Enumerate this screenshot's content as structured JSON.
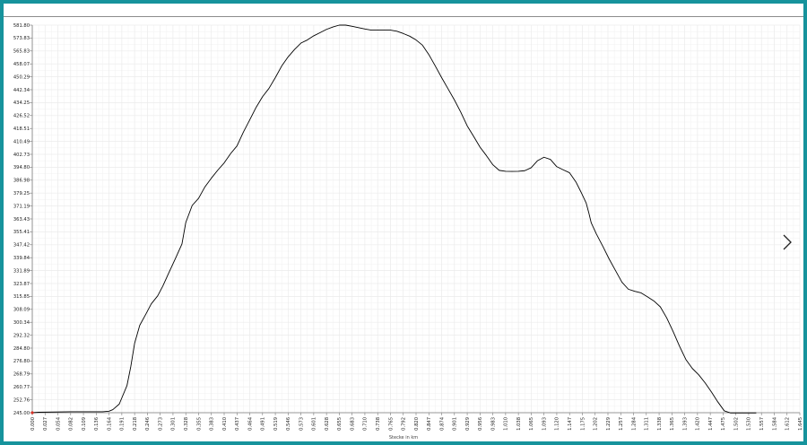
{
  "chart_data": {
    "type": "line",
    "title": "",
    "xlabel": "Stecke in km",
    "ylabel": "",
    "xlim": [
      0,
      1.645
    ],
    "ylim": [
      245,
      581.8
    ],
    "grid": true,
    "legend": "none",
    "colors": {
      "line": "#000000",
      "grid": "#ebebeb",
      "axis": "#7a7a7a",
      "tick_text": "#222222",
      "frame": "#16939c"
    },
    "y_ticks": [
      "245.00",
      "252.76",
      "260.77",
      "268.79",
      "276.80",
      "284.80",
      "292.32",
      "300.34",
      "308.09",
      "315.85",
      "323.87",
      "331.89",
      "339.84",
      "347.42",
      "355.41",
      "363.43",
      "371.19",
      "379.25",
      "386.98",
      "394.80",
      "402.73",
      "410.49",
      "418.51",
      "426.52",
      "434.25",
      "442.34",
      "450.29",
      "458.07",
      "565.83",
      "573.83",
      "581.80"
    ],
    "x_ticks": [
      "0.000",
      "0.027",
      "0.054",
      "0.082",
      "0.109",
      "0.136",
      "0.164",
      "0.191",
      "0.218",
      "0.246",
      "0.273",
      "0.301",
      "0.328",
      "0.355",
      "0.383",
      "0.410",
      "0.437",
      "0.464",
      "0.491",
      "0.519",
      "0.546",
      "0.573",
      "0.601",
      "0.628",
      "0.655",
      "0.683",
      "0.710",
      "0.738",
      "0.765",
      "0.792",
      "0.820",
      "0.847",
      "0.874",
      "0.901",
      "0.929",
      "0.956",
      "0.983",
      "1.010",
      "1.038",
      "1.065",
      "1.093",
      "1.120",
      "1.147",
      "1.175",
      "1.202",
      "1.229",
      "1.257",
      "1.284",
      "1.311",
      "1.338",
      "1.365",
      "1.393",
      "1.420",
      "1.447",
      "1.475",
      "1.502",
      "1.530",
      "1.557",
      "1.584",
      "1.612",
      "1.645"
    ],
    "x": [
      0,
      0.0137,
      0.0823,
      0.1508,
      0.1645,
      0.1727,
      0.1864,
      0.2029,
      0.2111,
      0.2193,
      0.2303,
      0.244,
      0.255,
      0.2687,
      0.2797,
      0.2934,
      0.3071,
      0.3208,
      0.329,
      0.3427,
      0.3564,
      0.3701,
      0.3838,
      0.3976,
      0.4113,
      0.425,
      0.4387,
      0.4524,
      0.4661,
      0.4798,
      0.4935,
      0.5072,
      0.5209,
      0.5346,
      0.5483,
      0.562,
      0.5758,
      0.5895,
      0.6032,
      0.6169,
      0.6306,
      0.6443,
      0.658,
      0.6717,
      0.6854,
      0.6991,
      0.7128,
      0.7265,
      0.7402,
      0.754,
      0.7677,
      0.7814,
      0.7951,
      0.8088,
      0.8225,
      0.8362,
      0.8499,
      0.8636,
      0.8773,
      0.891,
      0.9047,
      0.9184,
      0.9322,
      0.9459,
      0.9596,
      0.9733,
      0.987,
      1.0007,
      1.0144,
      1.0281,
      1.0418,
      1.0555,
      1.0692,
      1.0829,
      1.0966,
      1.1104,
      1.1241,
      1.1378,
      1.1515,
      1.1652,
      1.1762,
      1.1871,
      1.1926,
      1.198,
      1.209,
      1.2227,
      1.2364,
      1.2501,
      1.2638,
      1.2775,
      1.2912,
      1.3049,
      1.3186,
      1.3323,
      1.346,
      1.3597,
      1.3734,
      1.3871,
      1.4008,
      1.4145,
      1.4282,
      1.442,
      1.4557,
      1.4694,
      1.4831,
      1.4968,
      1.5105,
      1.5242,
      1.5379,
      1.5516,
      1.5653,
      1.579,
      1.5927,
      1.6064,
      1.6201,
      1.645
    ],
    "y": [
      245.0,
      245.4,
      245.8,
      245.8,
      246.3,
      247.7,
      252.5,
      268.5,
      285.0,
      305.3,
      320.9,
      331.1,
      339.6,
      346.5,
      355.0,
      367.3,
      379.2,
      391.6,
      410.3,
      425.1,
      431.3,
      441.3,
      448.8,
      455.8,
      462.1,
      470.1,
      476.8,
      488.8,
      499.5,
      510.4,
      519.6,
      526.8,
      536.2,
      546.3,
      554.2,
      560.6,
      566.2,
      568.9,
      572.5,
      575.3,
      578.1,
      580.2,
      581.8,
      581.8,
      580.8,
      579.6,
      578.4,
      577.5,
      577.5,
      577.5,
      577.5,
      576.5,
      574.5,
      572.2,
      568.9,
      564.4,
      556.2,
      546.4,
      536.2,
      526.5,
      516.8,
      506.1,
      494.2,
      485.1,
      475.8,
      468.4,
      460.5,
      455.6,
      454.8,
      454.7,
      454.8,
      455.3,
      457.9,
      464.0,
      467.0,
      465.1,
      458.8,
      456.1,
      453.5,
      445.5,
      436.6,
      427.2,
      418.9,
      409.9,
      400.3,
      389.7,
      378.5,
      368.4,
      358.4,
      352.3,
      350.5,
      349.1,
      345.7,
      342.1,
      337.0,
      327.4,
      315.6,
      302.8,
      291.2,
      283.5,
      278.0,
      270.9,
      262.9,
      254.3,
      246.6,
      244.8,
      244.8,
      244.8,
      244.8,
      244.8
    ]
  },
  "axis": {
    "x_title": "Stecke in km"
  },
  "icons": {
    "next": "chevron-right-icon"
  }
}
